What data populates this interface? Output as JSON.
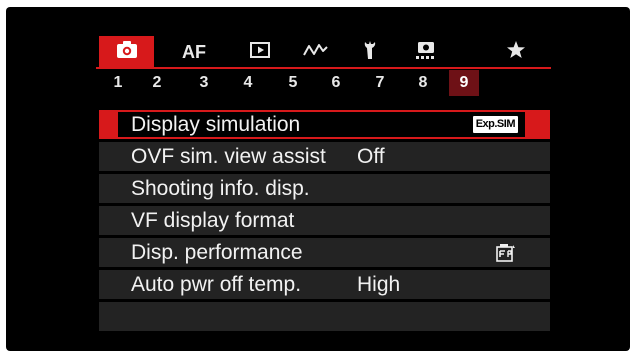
{
  "category_tabs": [
    {
      "icon": "camera-icon",
      "label": "",
      "active": true
    },
    {
      "icon": "",
      "label": "AF",
      "active": false
    },
    {
      "icon": "playback-icon",
      "label": "",
      "active": false
    },
    {
      "icon": "wireless-icon",
      "label": "",
      "active": false
    },
    {
      "icon": "wrench-icon",
      "label": "",
      "active": false
    },
    {
      "icon": "custom-function-icon",
      "label": "",
      "active": false
    },
    {
      "icon": "star-icon",
      "label": "",
      "active": false
    }
  ],
  "page_tabs": [
    "1",
    "2",
    "3",
    "4",
    "5",
    "6",
    "7",
    "8",
    "9"
  ],
  "active_page": "9",
  "menu": {
    "items": [
      {
        "label": "Display simulation",
        "value": "",
        "badge": "Exp.SIM",
        "selected": true
      },
      {
        "label": "OVF sim. view assist",
        "value": "Off"
      },
      {
        "label": "Shooting info. disp.",
        "value": ""
      },
      {
        "label": "VF display format",
        "value": ""
      },
      {
        "label": "Disp. performance",
        "value": "",
        "icon": "fps-priority-icon"
      },
      {
        "label": "Auto pwr off temp.",
        "value": "High"
      }
    ]
  },
  "colors": {
    "accent": "#d7191b",
    "active_page_bg": "#6e1116",
    "item_bg": "#232323",
    "screen_bg": "#000000"
  }
}
